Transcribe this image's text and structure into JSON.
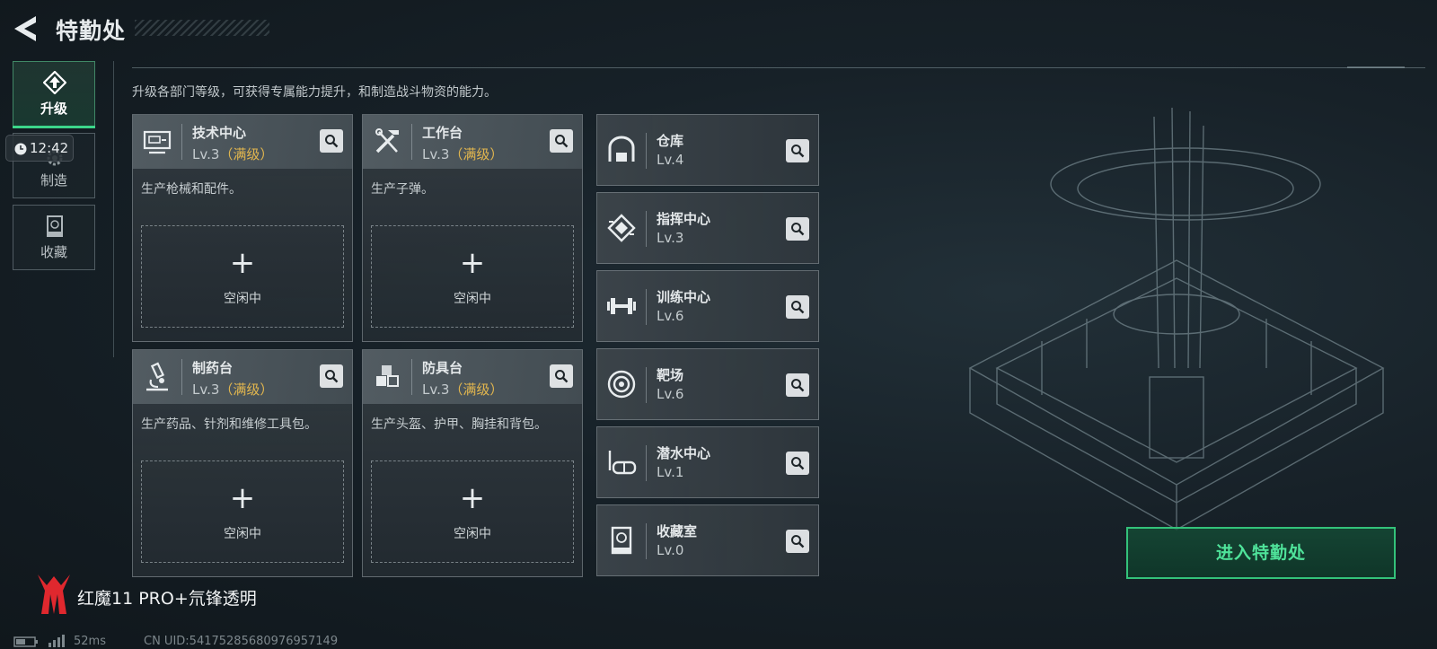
{
  "header": {
    "title": "特勤处"
  },
  "tabs": [
    {
      "label": "升级",
      "icon": "upgrade-icon",
      "active": true
    },
    {
      "label": "制造",
      "icon": "gears-icon",
      "active": false
    },
    {
      "label": "收藏",
      "icon": "collection-icon",
      "active": false
    }
  ],
  "clock": {
    "time": "12:42"
  },
  "description": "升级各部门等级，可获得专属能力提升，和制造战斗物资的能力。",
  "workshops": [
    {
      "name": "技术中心",
      "level": "Lv.3",
      "max_tag": "（满级）",
      "desc": "生产枪械和配件。",
      "slot_plus": "+",
      "slot_status": "空闲中",
      "icon": "computer-icon"
    },
    {
      "name": "工作台",
      "level": "Lv.3",
      "max_tag": "（满级）",
      "desc": "生产子弹。",
      "slot_plus": "+",
      "slot_status": "空闲中",
      "icon": "tools-icon"
    },
    {
      "name": "制药台",
      "level": "Lv.3",
      "max_tag": "（满级）",
      "desc": "生产药品、针剂和维修工具包。",
      "slot_plus": "+",
      "slot_status": "空闲中",
      "icon": "microscope-icon"
    },
    {
      "name": "防具台",
      "level": "Lv.3",
      "max_tag": "（满级）",
      "desc": "生产头盔、护甲、胸挂和背包。",
      "slot_plus": "+",
      "slot_status": "空闲中",
      "icon": "armor-crates-icon"
    }
  ],
  "facilities": [
    {
      "name": "仓库",
      "level": "Lv.4",
      "icon": "warehouse-icon"
    },
    {
      "name": "指挥中心",
      "level": "Lv.3",
      "icon": "command-chip-icon"
    },
    {
      "name": "训练中心",
      "level": "Lv.6",
      "icon": "dumbbell-icon"
    },
    {
      "name": "靶场",
      "level": "Lv.6",
      "icon": "target-icon"
    },
    {
      "name": "潜水中心",
      "level": "Lv.1",
      "icon": "diving-mask-icon"
    },
    {
      "name": "收藏室",
      "level": "Lv.0",
      "icon": "collection-room-icon"
    }
  ],
  "enter_button": "进入特勤处",
  "watermark": "红魔11 PRO+氘锋透明",
  "footer": {
    "ping": "52ms",
    "uid": "CN UID:54175285680976957149"
  },
  "colors": {
    "accent": "#3cd68a",
    "max_level": "#e2b64e",
    "button_text": "#4fe39a"
  }
}
